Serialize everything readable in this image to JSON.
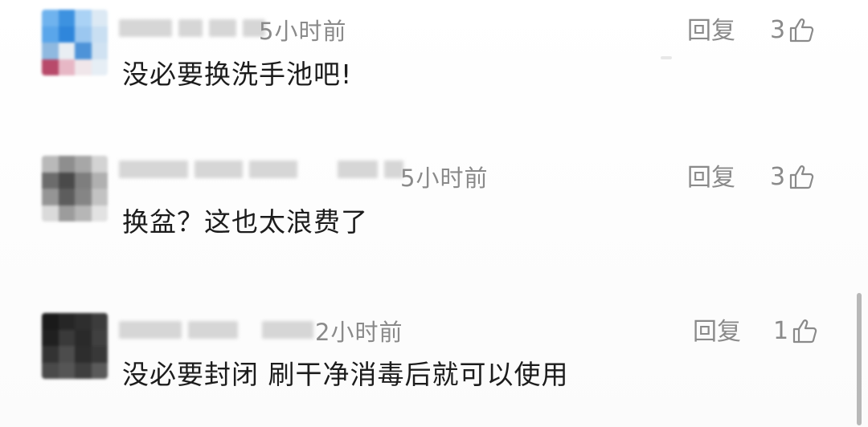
{
  "comments": [
    {
      "time": "5小时前",
      "text": "没必要换洗手池吧!",
      "reply_label": "回复",
      "likes": "3",
      "avatar_colors": [
        "#6fb3ee",
        "#3d92e0",
        "#aad2f5",
        "#dce9f4",
        "#5aa6ea",
        "#2f86db",
        "#9bc7f0",
        "#c9dff2",
        "#8fb9e0",
        "#e9eef3",
        "#4e93d8",
        "#d0e2f2",
        "#b84a6a",
        "#e7b7c5",
        "#f0e6ea",
        "#e6eef5"
      ]
    },
    {
      "time": "5小时前",
      "text": "换盆？这也太浪费了",
      "reply_label": "回复",
      "likes": "3",
      "avatar_colors": [
        "#b9b9b9",
        "#8e8e8e",
        "#a7a7a7",
        "#d3d3d3",
        "#6c6c6c",
        "#4a4a4a",
        "#7e7e7e",
        "#b0b0b0",
        "#959595",
        "#5d5d5d",
        "#858585",
        "#c2c2c2",
        "#dadada",
        "#9c9c9c",
        "#b6b6b6",
        "#e2e2e2"
      ]
    },
    {
      "time": "2小时前",
      "text": "没必要封闭 刷干净消毒后就可以使用",
      "reply_label": "回复",
      "likes": "1",
      "avatar_colors": [
        "#1a1a1a",
        "#262626",
        "#2e2e2e",
        "#3c3c3c",
        "#202020",
        "#3a3a3a",
        "#2a2a2a",
        "#404040",
        "#333333",
        "#4c4c4c",
        "#2d2d2d",
        "#383838",
        "#4a4a4a",
        "#555555",
        "#3f3f3f",
        "#5a5a5a"
      ]
    }
  ],
  "colors": {
    "text": "#1c1c1c",
    "muted": "#8a8a8a",
    "background": "#fdfdfd"
  }
}
